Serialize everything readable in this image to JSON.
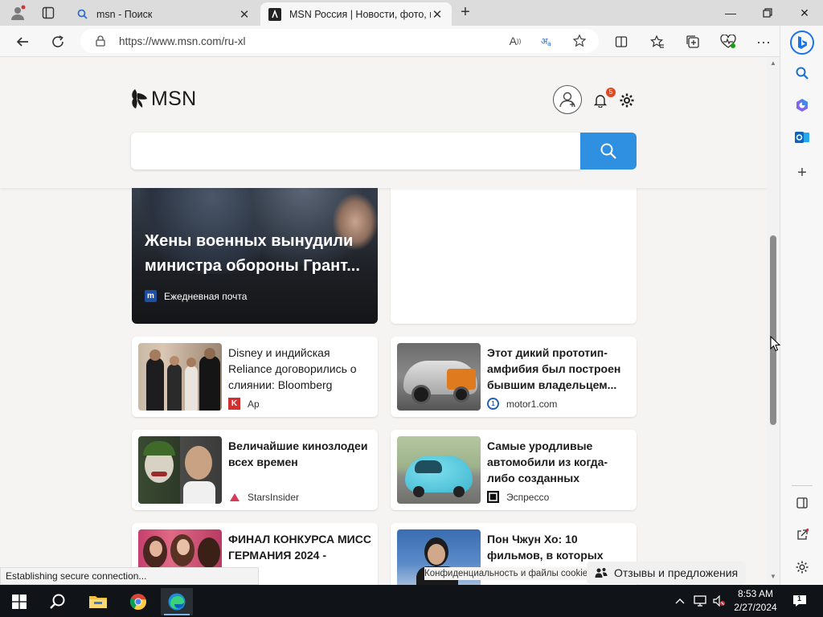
{
  "browser": {
    "tabs": [
      {
        "title": "msn - Поиск"
      },
      {
        "title": "MSN Россия | Новости, фото, погода"
      }
    ],
    "url": "https://www.msn.com/ru-xl"
  },
  "msn": {
    "logo": "MSN",
    "notification_count": "5",
    "search_placeholder": "",
    "hero": {
      "title_line1": "Жены военных вынудили",
      "title_line2": "министра обороны Грант...",
      "source": "Ежедневная почта"
    },
    "cards": [
      {
        "title": "Disney и индийская Reliance договорились о слиянии: Bloomberg",
        "source": "Ap"
      },
      {
        "title": "Этот дикий прототип-амфибия был построен бывшим владельцем...",
        "source": "motor1.com"
      },
      {
        "title": "Величайшие кинозлодеи всех времен",
        "source": "StarsInsider"
      },
      {
        "title": "Самые уродливые автомобили из когда-либо созданных",
        "source": "Эспрессо"
      },
      {
        "title": "ФИНАЛ КОНКУРСА МИСС ГЕРМАНИЯ 2024 -",
        "source": ""
      },
      {
        "title": "Пон Чжун Хо: 10 фильмов, в которых",
        "source": ""
      }
    ]
  },
  "status": {
    "loading": "Establishing secure connection...",
    "privacy_link": "Конфиденциальность и файлы cookie",
    "feedback": "Отзывы и предложения"
  },
  "taskbar": {
    "time": "8:53 AM",
    "date": "2/27/2024",
    "notifications": "1"
  },
  "colors": {
    "accent": "#2f8fe0",
    "badge": "#e0491f",
    "taskbar": "#101418"
  }
}
